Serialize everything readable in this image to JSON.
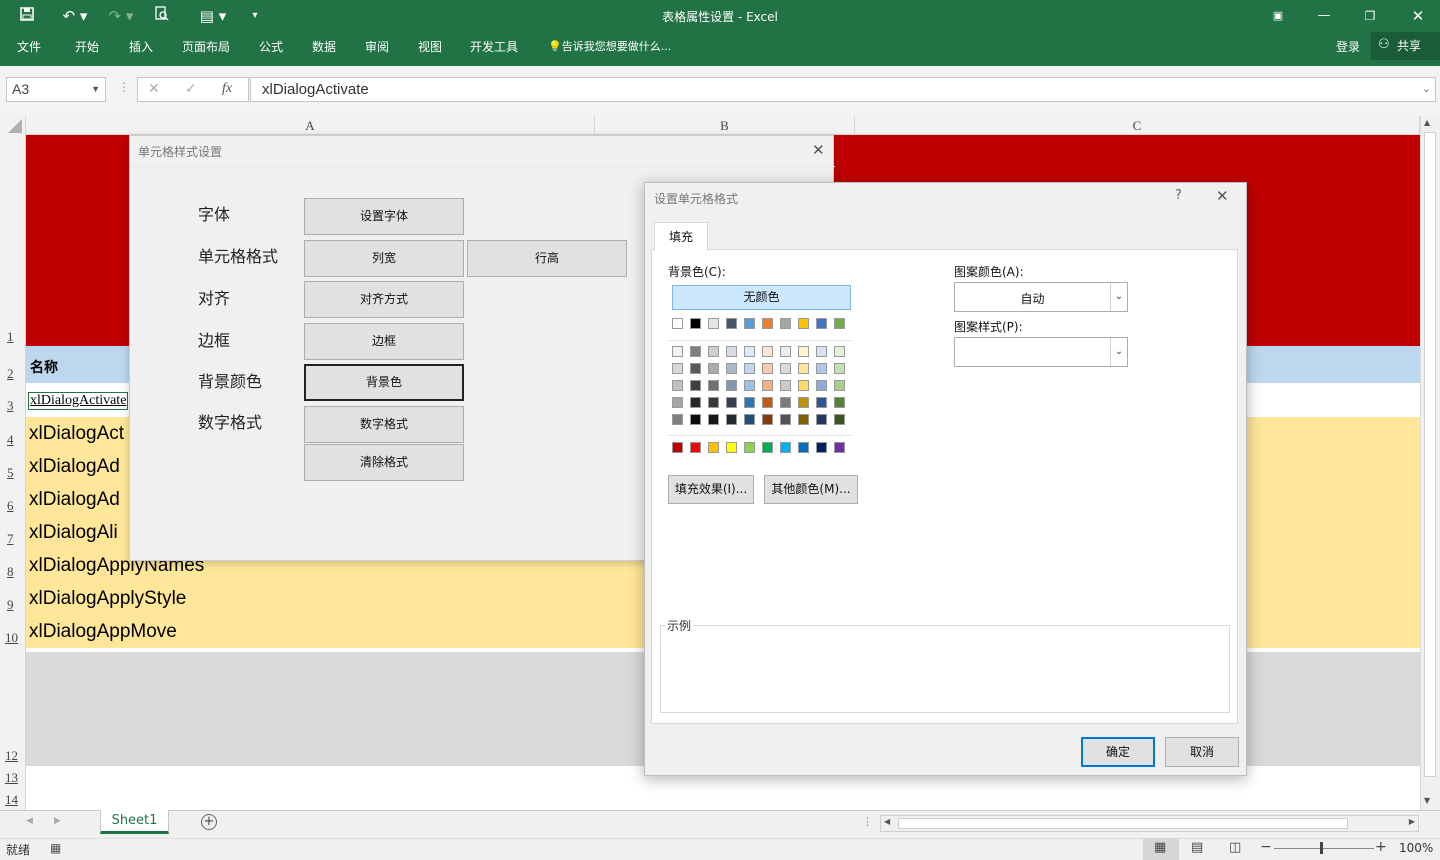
{
  "window": {
    "title": "表格属性设置 - Excel"
  },
  "ribbon": {
    "tabs": [
      "文件",
      "开始",
      "插入",
      "页面布局",
      "公式",
      "数据",
      "审阅",
      "视图",
      "开发工具"
    ],
    "tell_me": "告诉我您想要做什么...",
    "login": "登录",
    "share": "共享"
  },
  "formula_bar": {
    "name_box": "A3",
    "fx": "fx",
    "value": "xlDialogActivate"
  },
  "columns": [
    "A",
    "B",
    "C"
  ],
  "rows": [
    "1",
    "2",
    "3",
    "4",
    "5",
    "6",
    "7",
    "8",
    "9",
    "10",
    "12",
    "13",
    "14"
  ],
  "cells": {
    "header": "名称",
    "a3": "xlDialogActivate",
    "list": [
      "xlDialogAct",
      "xlDialogAd",
      "xlDialogAd",
      "xlDialogAli",
      "xlDialogApplyNames",
      "xlDialogApplyStyle",
      "xlDialogAppMove"
    ]
  },
  "dialog1": {
    "title": "单元格样式设置",
    "labels": [
      "字体",
      "单元格格式",
      "对齐",
      "边框",
      "背景颜色",
      "数字格式"
    ],
    "buttons": {
      "font": "设置字体",
      "col_width": "列宽",
      "row_height": "行高",
      "align": "对齐方式",
      "border": "边框",
      "background": "背景色",
      "number": "数字格式",
      "clear": "清除格式"
    }
  },
  "dialog2": {
    "title": "设置单元格格式",
    "help": "?",
    "tab": "填充",
    "bg_label": "背景色(C):",
    "no_color": "无颜色",
    "pattern_color_label": "图案颜色(A):",
    "pattern_color_value": "自动",
    "pattern_style_label": "图案样式(P):",
    "fill_effects": "填充效果(I)...",
    "more_colors": "其他颜色(M)...",
    "sample_label": "示例",
    "ok": "确定",
    "cancel": "取消",
    "theme_colors": [
      "#ffffff",
      "#000000",
      "#e7e6e6",
      "#44546a",
      "#5b9bd5",
      "#ed7d31",
      "#a5a5a5",
      "#ffc000",
      "#4472c4",
      "#70ad47"
    ],
    "tint_rows": [
      [
        "#f2f2f2",
        "#7f7f7f",
        "#d0cece",
        "#d6dce4",
        "#deebf6",
        "#fbe5d5",
        "#ededed",
        "#fff2cc",
        "#d9e2f3",
        "#e2efd9"
      ],
      [
        "#d8d8d8",
        "#595959",
        "#aeabab",
        "#adb9ca",
        "#bdd7ee",
        "#f7cbac",
        "#dbdbdb",
        "#fee599",
        "#b4c6e7",
        "#c5e0b3"
      ],
      [
        "#bfbfbf",
        "#3f3f3f",
        "#757070",
        "#8496b0",
        "#9cc3e5",
        "#f4b183",
        "#c9c9c9",
        "#ffd965",
        "#8eaadb",
        "#a8d08d"
      ],
      [
        "#a5a5a5",
        "#262626",
        "#3a3838",
        "#323f4f",
        "#2e75b5",
        "#c55a11",
        "#7b7b7b",
        "#bf9000",
        "#2f5496",
        "#538135"
      ],
      [
        "#7f7f7f",
        "#0c0c0c",
        "#171616",
        "#222a35",
        "#1f4e79",
        "#843c0b",
        "#525252",
        "#7f6000",
        "#1f3864",
        "#375623"
      ]
    ],
    "standard_colors": [
      "#c00000",
      "#ff0000",
      "#ffc000",
      "#ffff00",
      "#92d050",
      "#00b050",
      "#00b0f0",
      "#0070c0",
      "#002060",
      "#7030a0"
    ]
  },
  "sheet": {
    "tab": "Sheet1"
  },
  "status": {
    "ready": "就绪",
    "zoom": "100%"
  },
  "colors": {
    "excel_green": "#217346",
    "red_fill": "#c00000",
    "header_fill": "#bdd7ee",
    "row_fill": "#ffe699",
    "selected_swatch": "#cce8ff"
  }
}
